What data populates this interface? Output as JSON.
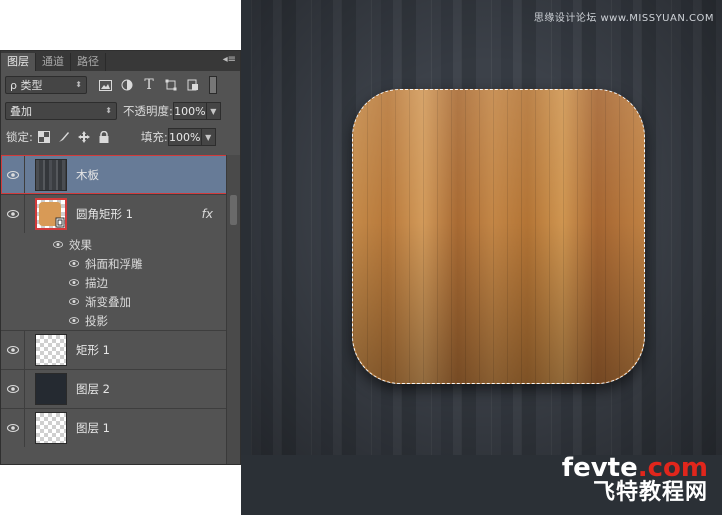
{
  "panel": {
    "tabs": [
      {
        "label": "图层",
        "active": true
      },
      {
        "label": "通道",
        "active": false
      },
      {
        "label": "路径",
        "active": false
      }
    ],
    "filter": {
      "kind_label": "ρ 类型",
      "icons": [
        "image-filter-icon",
        "adjustment-filter-icon",
        "text-filter-icon",
        "shape-filter-icon",
        "smart-object-filter-icon"
      ]
    },
    "blend": {
      "mode": "叠加",
      "opacity_label": "不透明度:",
      "opacity_value": "100%"
    },
    "lock": {
      "label": "锁定:",
      "fill_label": "填充:",
      "fill_value": "100%"
    },
    "layers": [
      {
        "name": "木板",
        "thumb": "wood",
        "selected": true
      },
      {
        "name": "圆角矩形 1",
        "thumb": "rounded",
        "fx": "fx"
      },
      {
        "name": "矩形 1",
        "thumb": "checker"
      },
      {
        "name": "图层 2",
        "thumb": "dark"
      },
      {
        "name": "图层 1",
        "thumb": "checker"
      }
    ],
    "effects_label": "效果",
    "effects": [
      "斜面和浮雕",
      "描边",
      "渐变叠加",
      "投影"
    ]
  },
  "canvas": {
    "watermark": "思缘设计论坛 www.MISSYUAN.COM",
    "brand_line1_a": "fevte",
    "brand_line1_b": ".com",
    "brand_line2": "飞特教程网"
  },
  "colors": {
    "panel_bg": "#535353",
    "selected_layer": "#677b97",
    "highlight_red": "#d23b3b",
    "wood_light": "#c48a49"
  }
}
